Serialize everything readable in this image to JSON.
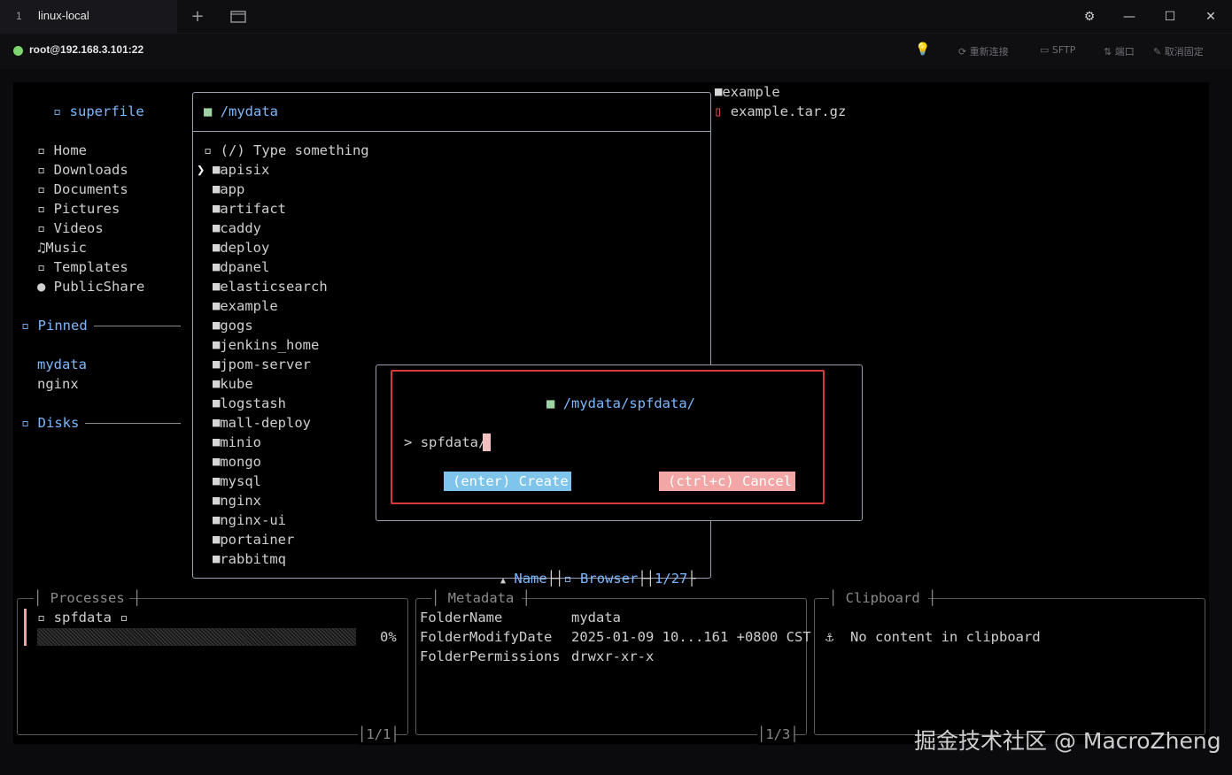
{
  "window": {
    "tab_number": "1",
    "tab_title": "linux-local",
    "new_tab_icon": "plus-icon",
    "tab_list_icon": "tab-list-icon",
    "settings_icon": "gear-icon",
    "minimize_icon": "minimize-icon",
    "maximize_icon": "maximize-icon",
    "close_icon": "close-icon"
  },
  "connection": {
    "status_color": "#7ed56f",
    "host": "root@192.168.3.101:22",
    "actions": [
      "重新连接",
      "SFTP",
      "端口",
      "取消固定"
    ]
  },
  "sidebar": {
    "title": "superfile",
    "items": [
      "Home",
      "Downloads",
      "Documents",
      "Pictures",
      "Videos",
      "Music",
      "Templates",
      "PublicShare"
    ],
    "pinned_label": "Pinned",
    "pinned": [
      "mydata",
      "nginx"
    ],
    "disks_label": "Disks"
  },
  "panel": {
    "path": "/mydata",
    "search_placeholder": "(/) Type something",
    "entries": [
      "apisix",
      "app",
      "artifact",
      "caddy",
      "deploy",
      "dpanel",
      "elasticsearch",
      "example",
      "gogs",
      "jenkins_home",
      "jpom-server",
      "kube",
      "logstash",
      "mall-deploy",
      "minio",
      "mongo",
      "mysql",
      "nginx",
      "nginx-ui",
      "portainer",
      "rabbitmq"
    ],
    "selected_index": 0,
    "footer_sort": "Name",
    "footer_mode": "Browser",
    "footer_count": "1/27"
  },
  "preview": {
    "items": [
      "example",
      "example.tar.gz"
    ]
  },
  "dialog": {
    "path": "/mydata/spfdata/",
    "prompt": ">",
    "input_value": "spfdata/",
    "create_label": "(enter) Create",
    "cancel_label": "(ctrl+c) Cancel"
  },
  "processes": {
    "title": "Processes",
    "item_name": "spfdata",
    "progress_text": "0%",
    "progress_fraction": 0,
    "count": "1/1"
  },
  "metadata": {
    "title": "Metadata",
    "rows": [
      {
        "key": "FolderName",
        "value": "mydata"
      },
      {
        "key": "FolderModifyDate",
        "value": "2025-01-09 10...161 +0800 CST"
      },
      {
        "key": "FolderPermissions",
        "value": "drwxr-xr-x"
      }
    ],
    "count": "1/3"
  },
  "clipboard": {
    "title": "Clipboard",
    "message": "No content in clipboard"
  },
  "watermark": "掘金技术社区 @ MacroZheng"
}
